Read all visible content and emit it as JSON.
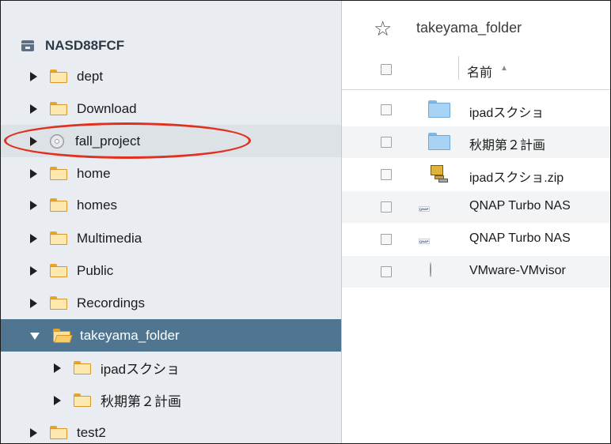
{
  "sidebar": {
    "root": {
      "label": "NASD88FCF",
      "icon": "nas-icon"
    },
    "items": [
      {
        "label": "dept",
        "icon": "folder-icon"
      },
      {
        "label": "Download",
        "icon": "folder-icon"
      },
      {
        "label": "fall_project",
        "icon": "disc-icon",
        "highlighted": true
      },
      {
        "label": "home",
        "icon": "folder-icon"
      },
      {
        "label": "homes",
        "icon": "folder-icon"
      },
      {
        "label": "Multimedia",
        "icon": "folder-icon"
      },
      {
        "label": "Public",
        "icon": "folder-icon"
      },
      {
        "label": "Recordings",
        "icon": "folder-icon"
      },
      {
        "label": "takeyama_folder",
        "icon": "folder-open-icon",
        "selected": true,
        "expanded": true
      },
      {
        "label": "ipadスクショ",
        "icon": "folder-icon",
        "child": true
      },
      {
        "label": "秋期第２計画",
        "icon": "folder-icon",
        "child": true
      },
      {
        "label": "test2",
        "icon": "folder-icon"
      }
    ]
  },
  "main": {
    "path": "takeyama_folder",
    "favorite_icon": "star-outline-icon",
    "columns": {
      "name": "名前",
      "sort": "ascending"
    },
    "files": [
      {
        "name": "ipadスクショ",
        "icon": "folder-icon"
      },
      {
        "name": "秋期第２計画",
        "icon": "folder-icon"
      },
      {
        "name": "ipadスクショ.zip",
        "icon": "zip-archive-icon"
      },
      {
        "name": "QNAP Turbo NAS",
        "icon": "qnap-logo-icon"
      },
      {
        "name": "QNAP Turbo NAS",
        "icon": "qnap-logo-icon"
      },
      {
        "name": "VMware-VMvisor",
        "icon": "disc-image-icon"
      }
    ]
  },
  "colors": {
    "sidebar_bg": "#e9edf1",
    "selected_row": "#4f7590",
    "highlight_ellipse": "#e03020",
    "folder_yellow": "#fde9b0",
    "folder_blue": "#a8d3f4"
  }
}
